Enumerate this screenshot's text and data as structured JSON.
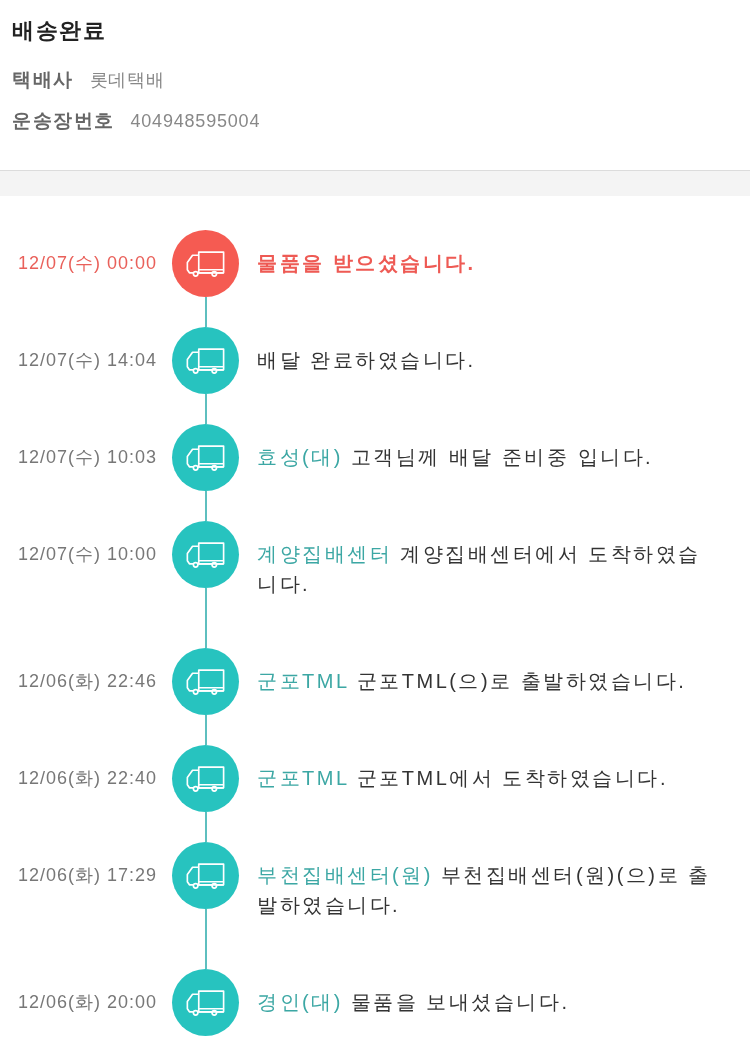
{
  "header": {
    "title": "배송완료",
    "fields": [
      {
        "label": "택배사",
        "value": "롯데택배"
      },
      {
        "label": "운송장번호",
        "value": "404948595004"
      }
    ]
  },
  "events": [
    {
      "time": "12/07(수) 00:00",
      "message": "물품을 받으셨습니다.",
      "current": true
    },
    {
      "time": "12/07(수) 14:04",
      "message": "배달 완료하였습니다.",
      "current": false
    },
    {
      "time": "12/07(수) 10:03",
      "place": "효성(대)",
      "message": "고객님께 배달 준비중 입니다.",
      "current": false
    },
    {
      "time": "12/07(수) 10:00",
      "place": "계양집배센터",
      "message": "계양집배센터에서 도착하였습니다.",
      "current": false
    },
    {
      "time": "12/06(화) 22:46",
      "place": "군포TML",
      "message": "군포TML(으)로 출발하였습니다.",
      "current": false
    },
    {
      "time": "12/06(화) 22:40",
      "place": "군포TML",
      "message": "군포TML에서 도착하였습니다.",
      "current": false
    },
    {
      "time": "12/06(화) 17:29",
      "place": "부천집배센터(원)",
      "message": "부천집배센터(원)(으)로 출발하였습니다.",
      "current": false
    },
    {
      "time": "12/06(화) 20:00",
      "place": "경인(대)",
      "message": "물품을 보내셨습니다.",
      "current": false
    }
  ]
}
